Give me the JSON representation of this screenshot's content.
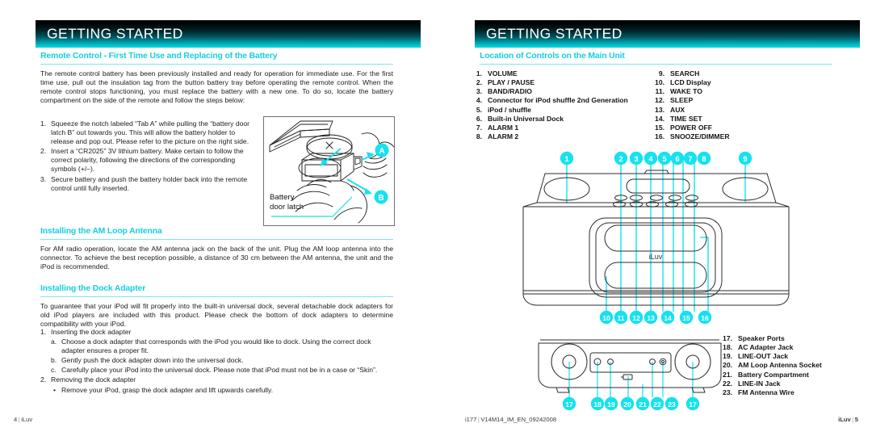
{
  "left_page": {
    "banner_title": "GETTING STARTED",
    "section1": {
      "heading": "Remote Control - First Time Use and Replacing of the Battery",
      "paragraph": "The remote control battery has been previously installed and ready for operation for immediate use. For the first time use, pull out the insulation tag from the button battery tray before operating the remote control.  When the remote control stops functioning, you must replace the battery with a new one. To do so, locate the battery compartment on the side of the remote and follow the steps below:",
      "steps": [
        {
          "num": "1.",
          "text": "Squeeze the notch labeled “Tab A” while pulling the “battery door latch B” out towards you. This will allow the battery holder to release and pop out. Please refer to the picture on the right side."
        },
        {
          "num": "2.",
          "text": "Insert a “CR2025” 3V lithium battery. Make certain to follow the correct polarity, following the directions of the corresponding symbols (+/–)."
        },
        {
          "num": "3.",
          "text": "Secure battery and push the battery holder back into the remote control until fully inserted."
        }
      ]
    },
    "figure_remote": {
      "name": "remote-battery-illustration",
      "caption_line1": "Battery",
      "caption_line2": "door latch",
      "callout_a": "A",
      "callout_b": "B"
    },
    "section2": {
      "heading": "Installing the AM Loop Antenna",
      "paragraph": "For AM radio operation, locate the AM antenna jack on the back of the unit. Plug the AM loop antenna into the connector. To achieve the best reception possible, a distance of 30 cm between the AM antenna, the unit and the iPod is recommended."
    },
    "section3": {
      "heading": "Installing the Dock Adapter",
      "paragraph": "To guarantee that your iPod will fit properly into the built-in universal dock, several detachable dock adapters for old iPod players are included with this product. Please check the bottom of dock adapters to determine compatibility with your iPod.",
      "steps": [
        {
          "num": "1.",
          "text": "Inserting the dock adapter"
        },
        {
          "num": "a.",
          "text": "Choose a dock adapter that corresponds with the iPod you would like to dock. Using the correct dock adapter ensures a proper fit."
        },
        {
          "num": "b.",
          "text": "Gently push the dock adapter down into the universal dock."
        },
        {
          "num": "c.",
          "text": "Carefully place your iPod into the universal dock. Please note that iPod must not be in a case or “Skin”."
        },
        {
          "num": "2.",
          "text": "Removing the dock adapter"
        },
        {
          "num": "•",
          "text": "Remove your iPod, grasp the dock adapter and lift upwards carefully."
        }
      ]
    },
    "footer": {
      "page_number": "4",
      "brand": "iLuv"
    }
  },
  "right_page": {
    "banner_title": "GETTING STARTED",
    "section1": {
      "heading": "Location of Controls on the Main Unit"
    },
    "controls_col1": [
      {
        "num": "1.",
        "label": "VOLUME"
      },
      {
        "num": "2.",
        "label": "PLAY / PAUSE"
      },
      {
        "num": "3.",
        "label": "BAND/RADIO"
      },
      {
        "num": "4.",
        "label": "Connector for iPod shuffle 2nd Generation"
      },
      {
        "num": "5.",
        "label": "iPod / shuffle"
      },
      {
        "num": "6.",
        "label": "Built-in Universal Dock"
      },
      {
        "num": "7.",
        "label": "ALARM 1"
      },
      {
        "num": "8.",
        "label": "ALARM 2"
      }
    ],
    "controls_col2": [
      {
        "num": "9.",
        "label": "SEARCH"
      },
      {
        "num": "10.",
        "label": "LCD Display"
      },
      {
        "num": "11.",
        "label": "WAKE TO"
      },
      {
        "num": "12.",
        "label": "SLEEP"
      },
      {
        "num": "13.",
        "label": "AUX"
      },
      {
        "num": "14.",
        "label": "TIME SET"
      },
      {
        "num": "15.",
        "label": "POWER OFF"
      },
      {
        "num": "16.",
        "label": "SNOOZE/DIMMER"
      }
    ],
    "controls_col3": [
      {
        "num": "17.",
        "label": "Speaker Ports"
      },
      {
        "num": "18.",
        "label": "AC Adapter Jack"
      },
      {
        "num": "19.",
        "label": "LINE-OUT Jack"
      },
      {
        "num": "20.",
        "label": "AM Loop Antenna Socket"
      },
      {
        "num": "21.",
        "label": "Battery Compartment"
      },
      {
        "num": "22.",
        "label": "LINE-IN Jack"
      },
      {
        "num": "23.",
        "label": "FM Antenna Wire"
      }
    ],
    "figure_front": {
      "name": "main-unit-front-view",
      "brand_mark": "iLuv",
      "callouts_top": [
        "1",
        "2",
        "3",
        "4",
        "5",
        "6",
        "7",
        "8",
        "9"
      ],
      "callouts_bottom": [
        "10",
        "11",
        "12",
        "13",
        "14",
        "15",
        "16"
      ]
    },
    "figure_rear": {
      "name": "main-unit-rear-view",
      "callouts": [
        "17",
        "18",
        "19",
        "20",
        "21",
        "22",
        "23",
        "17"
      ]
    },
    "footer": {
      "model": "i177",
      "doc_code": "V14M14_IM_EN_09242008",
      "brand": "iLuv",
      "page_number": "5"
    }
  },
  "colors": {
    "accent_cyan": "#17cfe0",
    "callout_cyan": "#15e2f0",
    "banner_dark": "#000000",
    "banner_teal": "#0bd4d9",
    "rule": "#7fe4ee",
    "line_art": "#2b2b2b"
  }
}
